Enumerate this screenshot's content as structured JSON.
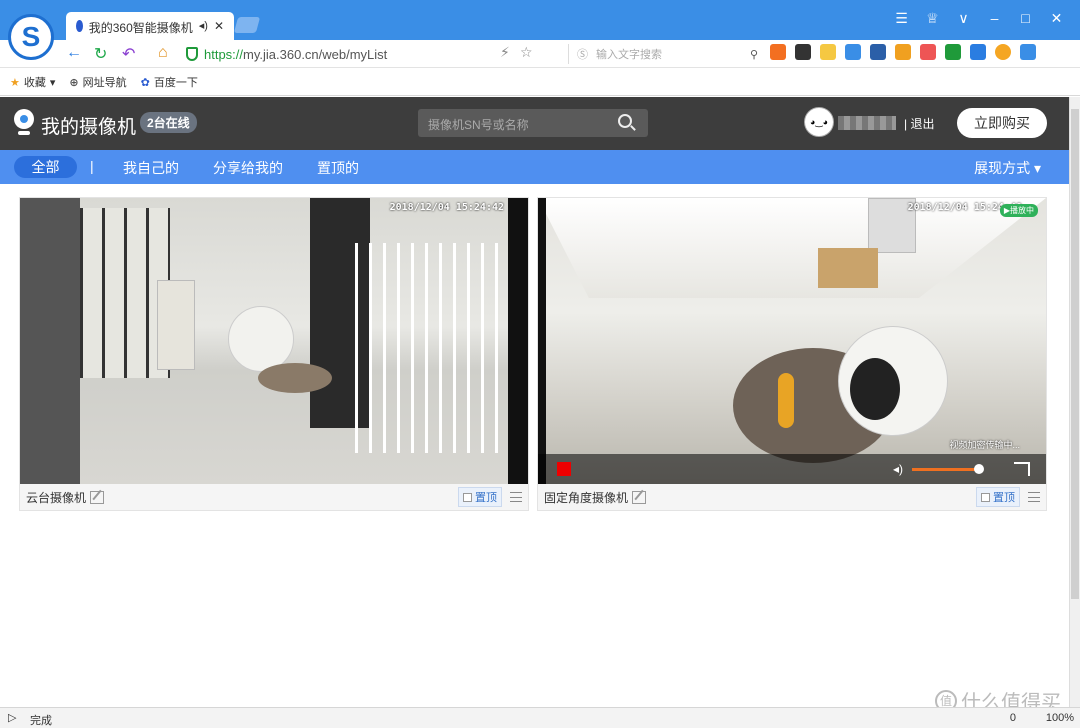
{
  "browser": {
    "tab_title": "我的360智能摄像机",
    "url_scheme": "https://",
    "url_rest": "my.jia.360.cn/web/myList",
    "search_placeholder": "输入文字搜索",
    "bookmarks": [
      "收藏",
      "网址导航",
      "百度一下"
    ]
  },
  "header": {
    "title": "我的摄像机",
    "online_badge": "2台在线",
    "search_placeholder": "摄像机SN号或名称",
    "logout": "退出",
    "buy_button": "立即购买"
  },
  "tabs": {
    "all": "全部",
    "separator": "|",
    "mine": "我自己的",
    "shared": "分享给我的",
    "pinned": "置顶的",
    "display_mode": "展现方式"
  },
  "cameras": [
    {
      "name": "云台摄像机",
      "timestamp": "2018/12/04 15:24:42",
      "pin_label": "置顶"
    },
    {
      "name": "固定角度摄像机",
      "timestamp": "2018/12/04 15:24:40",
      "pin_label": "置顶",
      "live_badge": "▶播放中",
      "encryption_text": "视频加密传输中..."
    }
  ],
  "status_bar": {
    "text": "完成",
    "zoom": "100%",
    "count": "0"
  },
  "watermark": "什么值得买",
  "colors": {
    "accent": "#4f8ff0",
    "header_bg": "#3d3d3d",
    "browser_blue": "#3a8ee6"
  }
}
